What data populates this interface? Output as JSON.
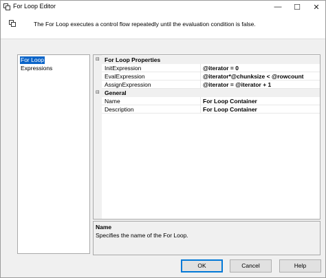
{
  "window": {
    "title": "For Loop Editor",
    "minimize_glyph": "—",
    "maximize_glyph": "☐",
    "close_glyph": "✕"
  },
  "header": {
    "description": "The For Loop executes a control flow repeatedly until the evaluation condition is false."
  },
  "nav": {
    "items": [
      {
        "label": "For Loop",
        "selected": true
      },
      {
        "label": "Expressions",
        "selected": false
      }
    ]
  },
  "grid": {
    "categories": [
      {
        "label": "For Loop Properties",
        "toggle": "⊟",
        "properties": [
          {
            "name": "InitExpression",
            "value": "@iterator = 0"
          },
          {
            "name": "EvalExpression",
            "value": "@iterator*@chunksize < @rowcount"
          },
          {
            "name": "AssignExpression",
            "value": "@iterator = @iterator + 1"
          }
        ]
      },
      {
        "label": "General",
        "toggle": "⊟",
        "properties": [
          {
            "name": "Name",
            "value": "For Loop Container"
          },
          {
            "name": "Description",
            "value": "For Loop Container"
          }
        ]
      }
    ]
  },
  "description_panel": {
    "title": "Name",
    "text": "Specifies the name of the For Loop."
  },
  "buttons": {
    "ok": "OK",
    "cancel": "Cancel",
    "help": "Help"
  },
  "colors": {
    "selection": "#0a64c8",
    "default_button_border": "#0078d7"
  }
}
